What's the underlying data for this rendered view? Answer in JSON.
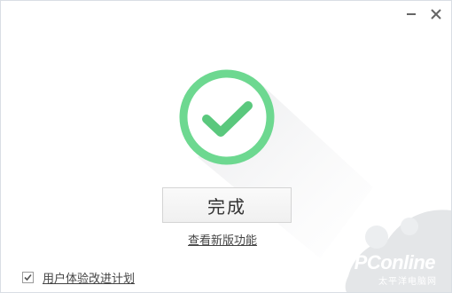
{
  "window": {
    "minimize_icon": "minimize-icon",
    "close_icon": "close-icon"
  },
  "status": {
    "icon": "checkmark-icon",
    "ring_color": "#6dd890",
    "check_color": "#5ac87d"
  },
  "actions": {
    "done_label": "完成",
    "whats_new_label": "查看新版功能"
  },
  "footer": {
    "ux_program_label": "用户体验改进计划",
    "ux_program_checked": true
  },
  "watermark": {
    "brand": "PConline",
    "tagline": "太平洋电脑网"
  }
}
